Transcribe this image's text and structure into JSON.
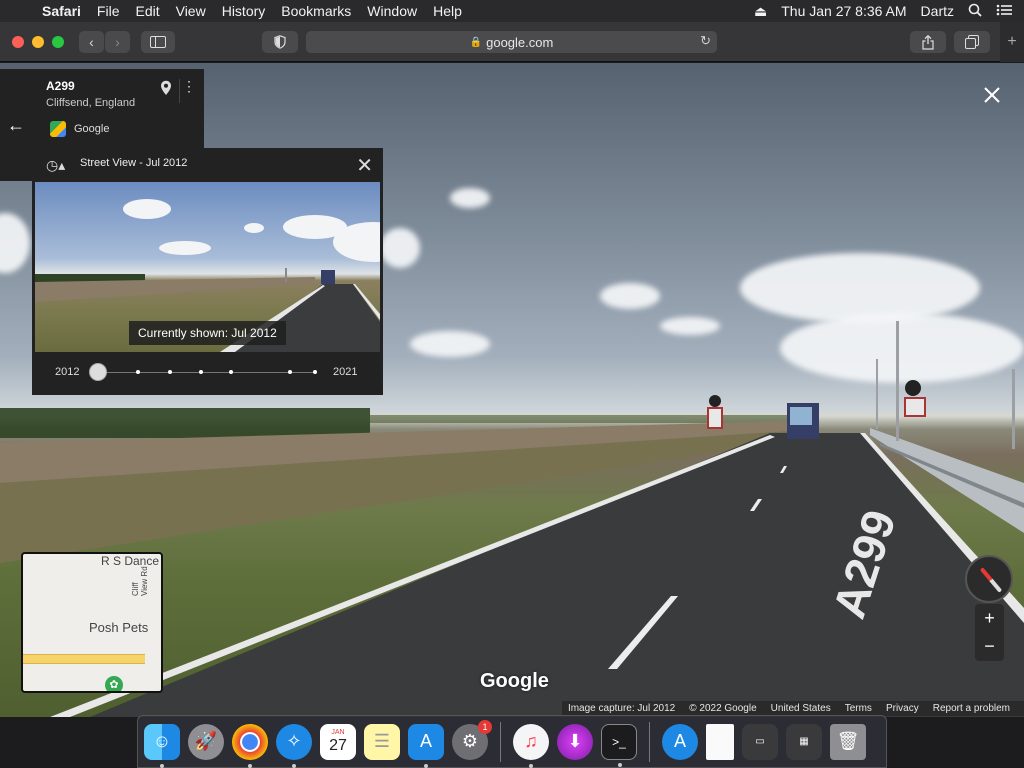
{
  "menubar": {
    "app": "Safari",
    "menus": [
      "File",
      "Edit",
      "View",
      "History",
      "Bookmarks",
      "Window",
      "Help"
    ],
    "datetime": "Thu Jan 27  8:36 AM",
    "user": "Dartz"
  },
  "toolbar": {
    "url": "google.com"
  },
  "infocard": {
    "title": "A299",
    "subtitle": "Cliffsend, England",
    "brand": "Google"
  },
  "timepanel": {
    "header": "Street View - Jul 2012",
    "current_tag": "Currently shown: Jul 2012",
    "year_start": "2012",
    "year_end": "2021"
  },
  "minimap": {
    "label_top": "R S Dance",
    "label_road": "Cliff View Rd",
    "label_poi": "Posh Pets"
  },
  "streetview": {
    "road_marking": "A299",
    "logo": "Google"
  },
  "footer": {
    "items": [
      "Image capture: Jul 2012",
      "© 2022 Google",
      "United States",
      "Terms",
      "Privacy",
      "Report a problem"
    ]
  },
  "dock": {
    "calendar_month": "JAN",
    "calendar_day": "27",
    "settings_badge": "1"
  }
}
